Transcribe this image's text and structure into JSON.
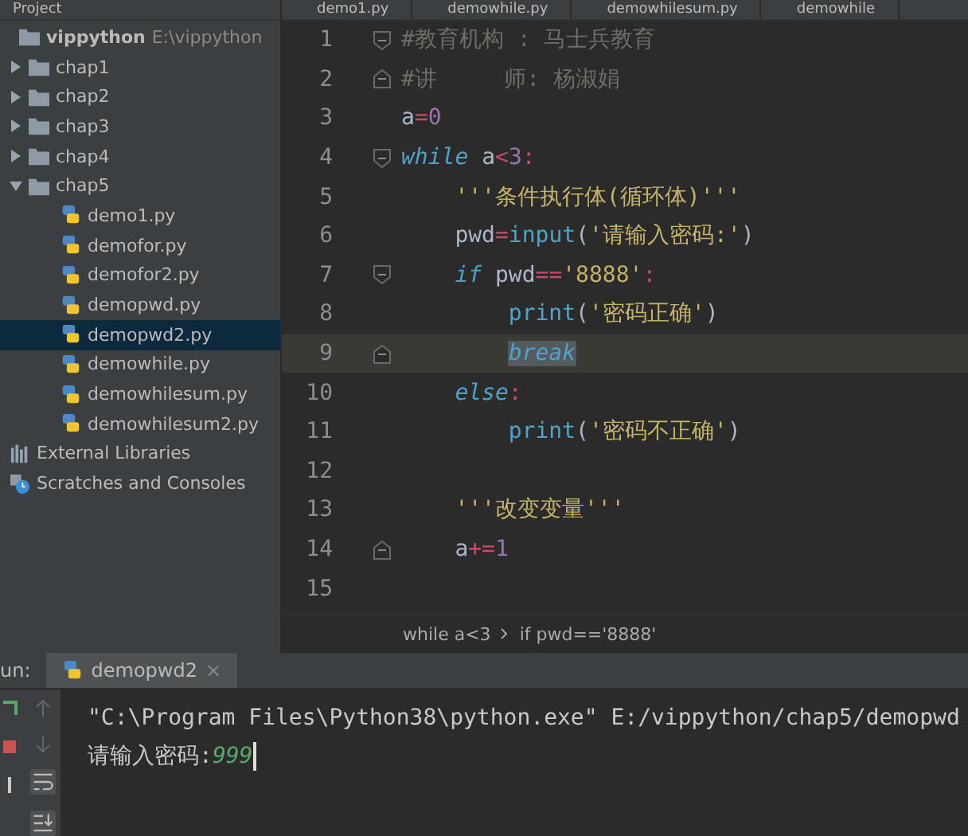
{
  "project_panel": {
    "title": "Project",
    "tree": [
      {
        "kind": "root",
        "label": "vippython",
        "path": "E:\\vippython",
        "children": [
          {
            "kind": "folder",
            "label": "chap1",
            "expanded": false,
            "selected": false
          },
          {
            "kind": "folder",
            "label": "chap2",
            "expanded": false,
            "selected": false
          },
          {
            "kind": "folder",
            "label": "chap3",
            "expanded": false,
            "selected": false
          },
          {
            "kind": "folder",
            "label": "chap4",
            "expanded": false,
            "selected": false
          },
          {
            "kind": "folder",
            "label": "chap5",
            "expanded": true,
            "selected": false,
            "children": [
              {
                "kind": "file",
                "label": "demo1.py",
                "selected": false
              },
              {
                "kind": "file",
                "label": "demofor.py",
                "selected": false
              },
              {
                "kind": "file",
                "label": "demofor2.py",
                "selected": false
              },
              {
                "kind": "file",
                "label": "demopwd.py",
                "selected": false
              },
              {
                "kind": "file",
                "label": "demopwd2.py",
                "selected": true
              },
              {
                "kind": "file",
                "label": "demowhile.py",
                "selected": false
              },
              {
                "kind": "file",
                "label": "demowhilesum.py",
                "selected": false
              },
              {
                "kind": "file",
                "label": "demowhilesum2.py",
                "selected": false
              }
            ]
          }
        ]
      },
      {
        "kind": "libraries",
        "label": "External Libraries"
      },
      {
        "kind": "scratches",
        "label": "Scratches and Consoles"
      }
    ]
  },
  "editor_tabs": [
    {
      "label": "demo1.py",
      "selected": false
    },
    {
      "label": "demowhile.py",
      "selected": false
    },
    {
      "label": "demowhilesum.py",
      "selected": false
    },
    {
      "label": "demowhile",
      "selected": false
    }
  ],
  "editor": {
    "lines": [
      {
        "number": "1",
        "fold_start": true,
        "fold_end": false,
        "current": false,
        "tokens": [
          {
            "t": "#教育机构 : 马士兵教育",
            "kind": "comment"
          }
        ]
      },
      {
        "number": "2",
        "fold_start": false,
        "fold_end": true,
        "current": false,
        "tokens": [
          {
            "t": "#讲     师: 杨淑娟",
            "kind": "comment"
          }
        ]
      },
      {
        "number": "3",
        "fold_start": false,
        "fold_end": false,
        "current": false,
        "tokens": [
          {
            "t": "a",
            "kind": "ident"
          },
          {
            "t": "=",
            "kind": "op"
          },
          {
            "t": "0",
            "kind": "num"
          }
        ]
      },
      {
        "number": "4",
        "fold_start": true,
        "fold_end": false,
        "current": false,
        "tokens": [
          {
            "t": "while",
            "kind": "kw"
          },
          {
            "t": " a",
            "kind": "ident"
          },
          {
            "t": "<",
            "kind": "op"
          },
          {
            "t": "3",
            "kind": "num"
          },
          {
            "t": ":",
            "kind": "op"
          }
        ],
        "children": [
          {
            "number": "5",
            "fold_start": false,
            "fold_end": false,
            "current": false,
            "tokens": [
              {
                "t": "'''条件执行体(循环体)'''",
                "kind": "str"
              }
            ]
          },
          {
            "number": "6",
            "fold_start": false,
            "fold_end": false,
            "current": false,
            "tokens": [
              {
                "t": "pwd",
                "kind": "ident"
              },
              {
                "t": "=",
                "kind": "op"
              },
              {
                "t": "input",
                "kind": "func"
              },
              {
                "t": "(",
                "kind": "ident"
              },
              {
                "t": "'请输入密码:'",
                "kind": "str"
              },
              {
                "t": ")",
                "kind": "ident"
              }
            ]
          },
          {
            "number": "7",
            "fold_start": true,
            "fold_end": false,
            "current": false,
            "tokens": [
              {
                "t": "if",
                "kind": "kw"
              },
              {
                "t": " pwd",
                "kind": "ident"
              },
              {
                "t": "==",
                "kind": "op"
              },
              {
                "t": "'8888'",
                "kind": "str"
              },
              {
                "t": ":",
                "kind": "op"
              }
            ],
            "children": [
              {
                "number": "8",
                "fold_start": false,
                "fold_end": false,
                "current": false,
                "tokens": [
                  {
                    "t": "print",
                    "kind": "func"
                  },
                  {
                    "t": "(",
                    "kind": "ident"
                  },
                  {
                    "t": "'密码正确'",
                    "kind": "str"
                  },
                  {
                    "t": ")",
                    "kind": "ident"
                  }
                ]
              },
              {
                "number": "9",
                "fold_start": false,
                "fold_end": true,
                "current": true,
                "tokens": [
                  {
                    "t": "break",
                    "kind": "kw",
                    "selected": true
                  }
                ]
              }
            ]
          },
          {
            "number": "10",
            "fold_start": false,
            "fold_end": false,
            "current": false,
            "tokens": [
              {
                "t": "else",
                "kind": "kw"
              },
              {
                "t": ":",
                "kind": "op"
              }
            ],
            "children": [
              {
                "number": "11",
                "fold_start": false,
                "fold_end": false,
                "current": false,
                "tokens": [
                  {
                    "t": "print",
                    "kind": "func"
                  },
                  {
                    "t": "(",
                    "kind": "ident"
                  },
                  {
                    "t": "'密码不正确'",
                    "kind": "str"
                  },
                  {
                    "t": ")",
                    "kind": "ident"
                  }
                ]
              }
            ]
          },
          {
            "number": "12",
            "fold_start": false,
            "fold_end": false,
            "current": false
          },
          {
            "number": "13",
            "fold_start": false,
            "fold_end": false,
            "current": false,
            "tokens": [
              {
                "t": "'''改变变量'''",
                "kind": "str"
              }
            ]
          },
          {
            "number": "14",
            "fold_start": false,
            "fold_end": true,
            "current": false,
            "tokens": [
              {
                "t": "a",
                "kind": "ident"
              },
              {
                "t": "+=",
                "kind": "op"
              },
              {
                "t": "1",
                "kind": "num"
              }
            ]
          }
        ]
      },
      {
        "number": "15",
        "fold_start": false,
        "fold_end": false,
        "current": false
      }
    ],
    "breadcrumbs": [
      "while a<3",
      "if pwd=='8888'"
    ]
  },
  "run_panel": {
    "label": "un:",
    "tab": {
      "label": "demopwd2",
      "close": "×",
      "selected": true
    },
    "console": {
      "command": "\"C:\\Program Files\\Python38\\python.exe\" E:/vippython/chap5/demopwd",
      "prompt": "请输入密码:",
      "input": "999"
    }
  }
}
